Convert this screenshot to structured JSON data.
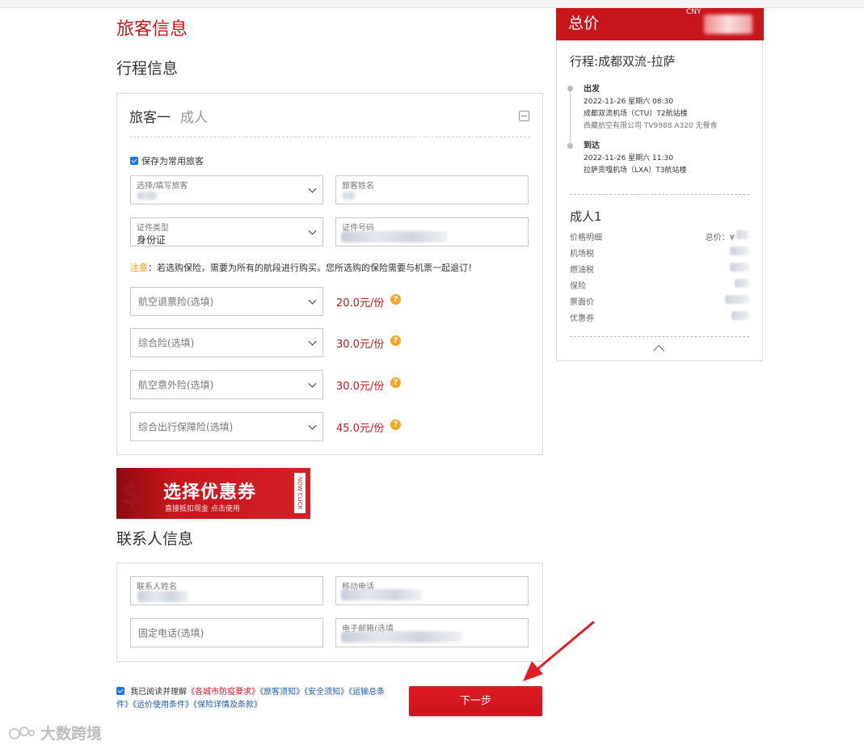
{
  "page": {
    "title": "旅客信息",
    "subtitle": "行程信息",
    "contact_title": "联系人信息"
  },
  "passenger": {
    "heading": "旅客一",
    "type": "成人",
    "save_label": "保存为常用旅客",
    "select_label": "选择/填写旅客",
    "name_label": "旅客姓名",
    "doc_type_label": "证件类型",
    "doc_type_value": "身份证",
    "doc_number_label": "证件号码",
    "notice_prefix": "注意",
    "notice_text": "：若选购保险，需要为所有的航段进行购买。您所选购的保险需要与机票一起退订！"
  },
  "insurance": [
    {
      "placeholder": "航空退票险(选填)",
      "price": "20.0元/份"
    },
    {
      "placeholder": "综合险(选填)",
      "price": "30.0元/份"
    },
    {
      "placeholder": "航空意外险(选填)",
      "price": "30.0元/份"
    },
    {
      "placeholder": "综合出行保障险(选填)",
      "price": "45.0元/份"
    }
  ],
  "coupon_banner": {
    "title": "选择优惠券",
    "subtitle": "直接抵扣现金  点击使用",
    "tag": "NOW CLICK",
    "symbol": "$"
  },
  "contact": {
    "name_label": "联系人姓名",
    "mobile_label": "移动电话",
    "landline_placeholder": "固定电话(选填)",
    "email_label": "电子邮箱(选填"
  },
  "agreement": {
    "prefix": "我已阅读并理解",
    "link_red": "《各城市防疫要求》",
    "links": [
      "《旅客须知》",
      "《安全须知》",
      "《运输总条件》",
      "《运价使用条件》",
      "《保险详情及条款》"
    ]
  },
  "next_button": "下一步",
  "watermark": "大数跨境",
  "summary": {
    "title": "总价",
    "currency": "CNY",
    "route": "行程:成都双流-拉萨",
    "depart": {
      "label": "出发",
      "datetime": "2022-11-26  星期六  08:30",
      "airport": "成都双流机场（CTU）T2航站楼",
      "flight": "西藏航空有限公司 TV9988 A320 无餐食"
    },
    "arrive": {
      "label": "到达",
      "datetime": "2022-11-26  星期六  11:30",
      "airport": "拉萨贡嘎机场（LXA）T3航站楼"
    },
    "adult_label": "成人1",
    "detail_label": "价格明细",
    "total_label": "总价：¥",
    "rows": [
      "机场税",
      "燃油税",
      "保险",
      "票面价",
      "优惠券"
    ]
  },
  "colors": {
    "brand_red": "#c8161d",
    "link_blue": "#1a5bb0",
    "warn_orange": "#f39800",
    "help_orange": "#f5a623"
  }
}
